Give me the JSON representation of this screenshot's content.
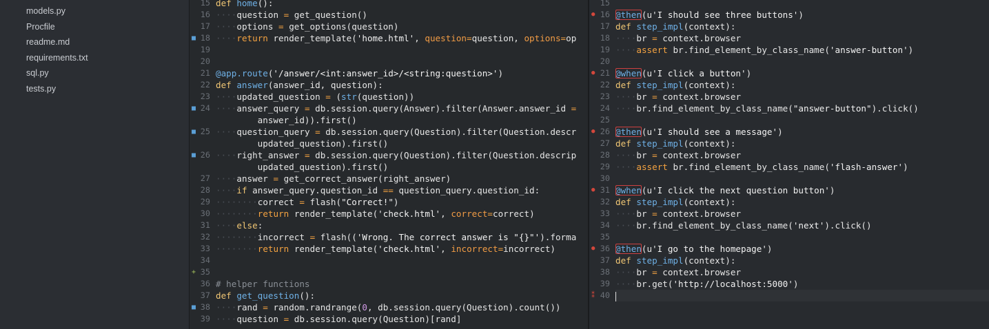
{
  "sidebar": {
    "files": [
      "models.py",
      "Procfile",
      "readme.md",
      "requirements.txt",
      "sql.py",
      "tests.py"
    ]
  },
  "left_editor": {
    "lines": [
      {
        "n": "15",
        "code": "def home():"
      },
      {
        "n": "16",
        "code": "····question = get_question()"
      },
      {
        "n": "17",
        "code": "····options = get_options(question)"
      },
      {
        "n": "18",
        "code": "····return render_template('home.html', question=question, options=op",
        "marker": "mod"
      },
      {
        "n": "19",
        "code": ""
      },
      {
        "n": "20",
        "code": ""
      },
      {
        "n": "21",
        "code": "@app.route('/answer/<int:answer_id>/<string:question>')"
      },
      {
        "n": "22",
        "code": "def answer(answer_id, question):"
      },
      {
        "n": "23",
        "code": "····updated_question = (str(question))"
      },
      {
        "n": "24",
        "code": "····answer_query = db.session.query(Answer).filter(Answer.answer_id =",
        "marker": "mod"
      },
      {
        "n": "",
        "code": "        answer_id)).first()"
      },
      {
        "n": "25",
        "code": "····question_query = db.session.query(Question).filter(Question.descr",
        "marker": "mod"
      },
      {
        "n": "",
        "code": "        updated_question).first()"
      },
      {
        "n": "26",
        "code": "····right_answer = db.session.query(Question).filter(Question.descrip",
        "marker": "mod"
      },
      {
        "n": "",
        "code": "        updated_question).first()"
      },
      {
        "n": "27",
        "code": "····answer = get_correct_answer(right_answer)"
      },
      {
        "n": "28",
        "code": "····if answer_query.question_id == question_query.question_id:"
      },
      {
        "n": "29",
        "code": "········correct = flash(\"Correct!\")"
      },
      {
        "n": "30",
        "code": "········return render_template('check.html', correct=correct)"
      },
      {
        "n": "31",
        "code": "····else:"
      },
      {
        "n": "32",
        "code": "········incorrect = flash(('Wrong. The correct answer is \"{}\"').forma"
      },
      {
        "n": "33",
        "code": "········return render_template('check.html', incorrect=incorrect)"
      },
      {
        "n": "34",
        "code": ""
      },
      {
        "n": "35",
        "code": "",
        "marker": "add"
      },
      {
        "n": "36",
        "code": "# helper functions"
      },
      {
        "n": "37",
        "code": "def get_question():"
      },
      {
        "n": "38",
        "code": "····rand = random.randrange(0, db.session.query(Question).count())",
        "marker": "mod"
      },
      {
        "n": "39",
        "code": "····question = db.session.query(Question)[rand]"
      }
    ]
  },
  "right_editor": {
    "lines": [
      {
        "n": "15",
        "code": ""
      },
      {
        "n": "16",
        "code": "@then(u'I should see three buttons')",
        "marker": "err"
      },
      {
        "n": "17",
        "code": "def step_impl(context):"
      },
      {
        "n": "18",
        "code": "····br = context.browser"
      },
      {
        "n": "19",
        "code": "····assert br.find_element_by_class_name('answer-button')"
      },
      {
        "n": "20",
        "code": ""
      },
      {
        "n": "21",
        "code": "@when(u'I click a button')",
        "marker": "err"
      },
      {
        "n": "22",
        "code": "def step_impl(context):"
      },
      {
        "n": "23",
        "code": "····br = context.browser"
      },
      {
        "n": "24",
        "code": "····br.find_element_by_class_name(\"answer-button\").click()"
      },
      {
        "n": "25",
        "code": ""
      },
      {
        "n": "26",
        "code": "@then(u'I should see a message')",
        "marker": "err"
      },
      {
        "n": "27",
        "code": "def step_impl(context):"
      },
      {
        "n": "28",
        "code": "····br = context.browser"
      },
      {
        "n": "29",
        "code": "····assert br.find_element_by_class_name('flash-answer')"
      },
      {
        "n": "30",
        "code": ""
      },
      {
        "n": "31",
        "code": "@when(u'I click the next question button')",
        "marker": "err"
      },
      {
        "n": "32",
        "code": "def step_impl(context):"
      },
      {
        "n": "33",
        "code": "····br = context.browser"
      },
      {
        "n": "34",
        "code": "····br.find_element_by_class_name('next').click()"
      },
      {
        "n": "35",
        "code": ""
      },
      {
        "n": "36",
        "code": "@then(u'I go to the homepage')",
        "marker": "err"
      },
      {
        "n": "37",
        "code": "def step_impl(context):"
      },
      {
        "n": "38",
        "code": "····br = context.browser"
      },
      {
        "n": "39",
        "code": "····br.get('http://localhost:5000')"
      },
      {
        "n": "40",
        "code": "",
        "marker": "conf",
        "current": true
      }
    ]
  },
  "colors": {
    "keyword": "#f0c674",
    "function": "#6fb1e7",
    "param": "#f29c45",
    "marker_modified": "#5b9fd6",
    "marker_added": "#a6c45c",
    "marker_error": "#d2473c"
  }
}
